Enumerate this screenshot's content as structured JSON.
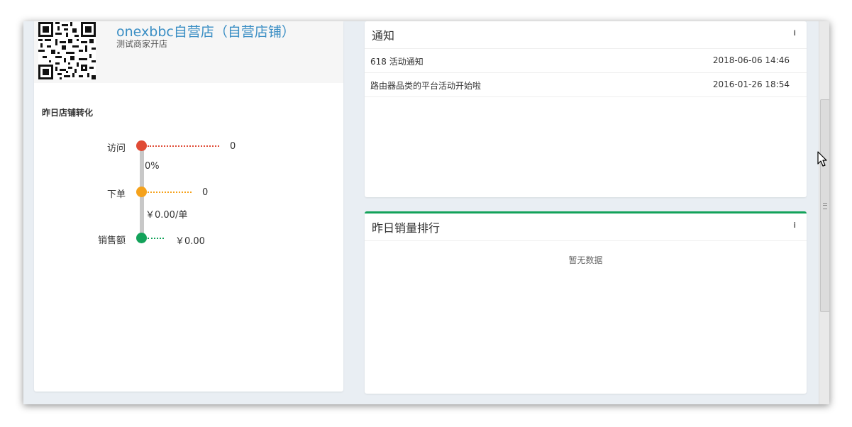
{
  "store": {
    "name": "onexbbc自营店（自营店铺）",
    "subtitle": "测试商家开店"
  },
  "conversion": {
    "title": "昨日店铺转化",
    "visit_label": "访问",
    "visit_value": "0",
    "visit_to_order_rate": "0%",
    "order_label": "下单",
    "order_value": "0",
    "avg_per_order": "￥0.00/单",
    "sales_label": "销售额",
    "sales_value": "￥0.00",
    "colors": {
      "visit": "#e04b35",
      "order": "#f5a21c",
      "sales": "#13a25a"
    }
  },
  "notice": {
    "title": "通知",
    "info_icon": "i",
    "items": [
      {
        "text": "618 活动通知",
        "date": "2018-06-06 14:46"
      },
      {
        "text": "路由器品类的平台活动开始啦",
        "date": "2016-01-26 18:54"
      }
    ]
  },
  "ranking": {
    "title": "昨日销量排行",
    "info_icon": "i",
    "empty_text": "暂无数据",
    "accent_color": "#13a25a"
  }
}
